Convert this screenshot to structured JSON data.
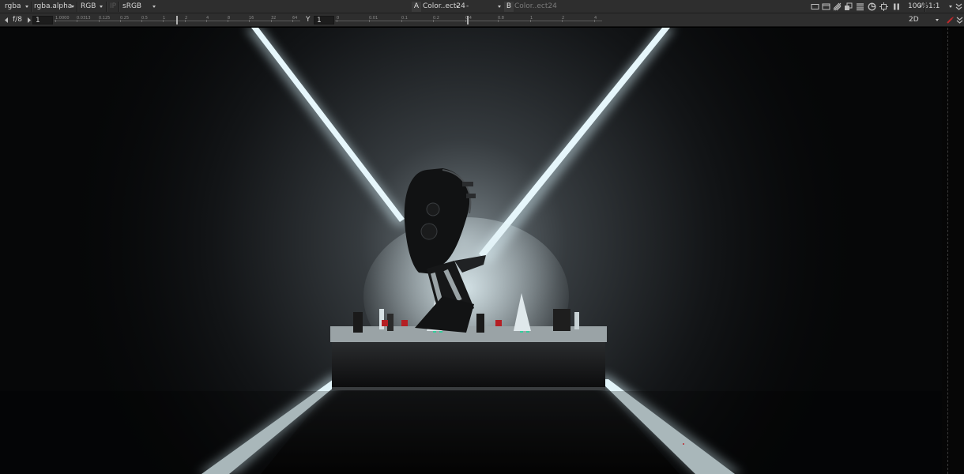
{
  "top_bar": {
    "channels": "rgba",
    "alpha_channel": "rgba.alpha",
    "display_channels": "RGB",
    "ip_label": "IP",
    "colorspace": "sRGB",
    "input_a_letter": "A",
    "input_a_value": "Color..ect24",
    "compare_mode": "-",
    "input_b_letter": "B",
    "input_b_value": "Color..ect24",
    "zoom": "100%",
    "proxy": "1:1"
  },
  "second_bar": {
    "fstop": "f/8",
    "gain_value": "1",
    "gamma_label": "Y",
    "gamma_value": "1",
    "view_mode": "2D",
    "gain_ticks": [
      "1.0000",
      "0.0313",
      "0.125",
      "0.25",
      "0.5",
      "1",
      "2",
      "4",
      "8",
      "16",
      "32",
      "64"
    ],
    "gamma_ticks": [
      "0",
      "0.01",
      "0.1",
      "0.2",
      "0.4",
      "0.8",
      "1",
      "2",
      "4"
    ]
  },
  "icons": [
    "roi-icon",
    "safe-area-icon",
    "checkerboard-icon",
    "wipe-icon",
    "overlay-icon",
    "lut-icon",
    "clip-warning-icon",
    "pause-icon",
    "expand-icon"
  ],
  "colors": {
    "toolbar": "#2e2e2e",
    "field": "#1c1c1c",
    "accent_red": "#c0282b",
    "light_beam": "#dff4fb"
  }
}
